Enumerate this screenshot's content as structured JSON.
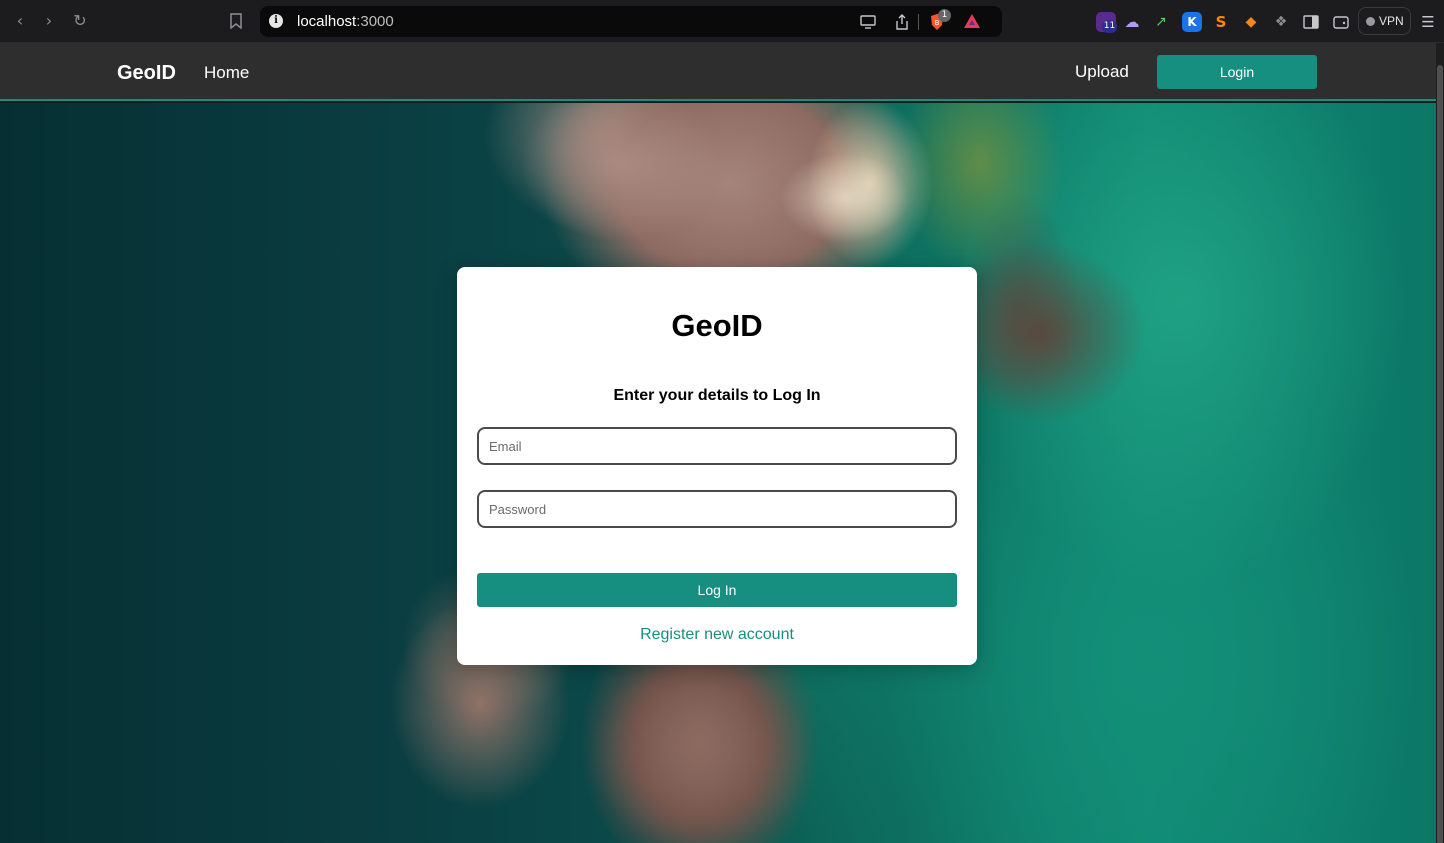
{
  "browser": {
    "url_host": "localhost",
    "url_port": ":3000",
    "nav_icons": [
      "back-icon",
      "forward-icon",
      "reload-icon",
      "bookmark-icon"
    ],
    "brave_badge": "1",
    "extension_badge": "11",
    "vpn_label": "VPN"
  },
  "header": {
    "brand": "GeoID",
    "home_label": "Home",
    "upload_label": "Upload",
    "login_label": "Login"
  },
  "login_card": {
    "title": "GeoID",
    "subtitle": "Enter your details to Log In",
    "email_placeholder": "Email",
    "password_placeholder": "Password",
    "submit_label": "Log In",
    "register_label": "Register new account"
  },
  "colors": {
    "accent": "#178f80",
    "header_bg": "#2e2e2e",
    "browser_bg": "#1c1c1e"
  }
}
